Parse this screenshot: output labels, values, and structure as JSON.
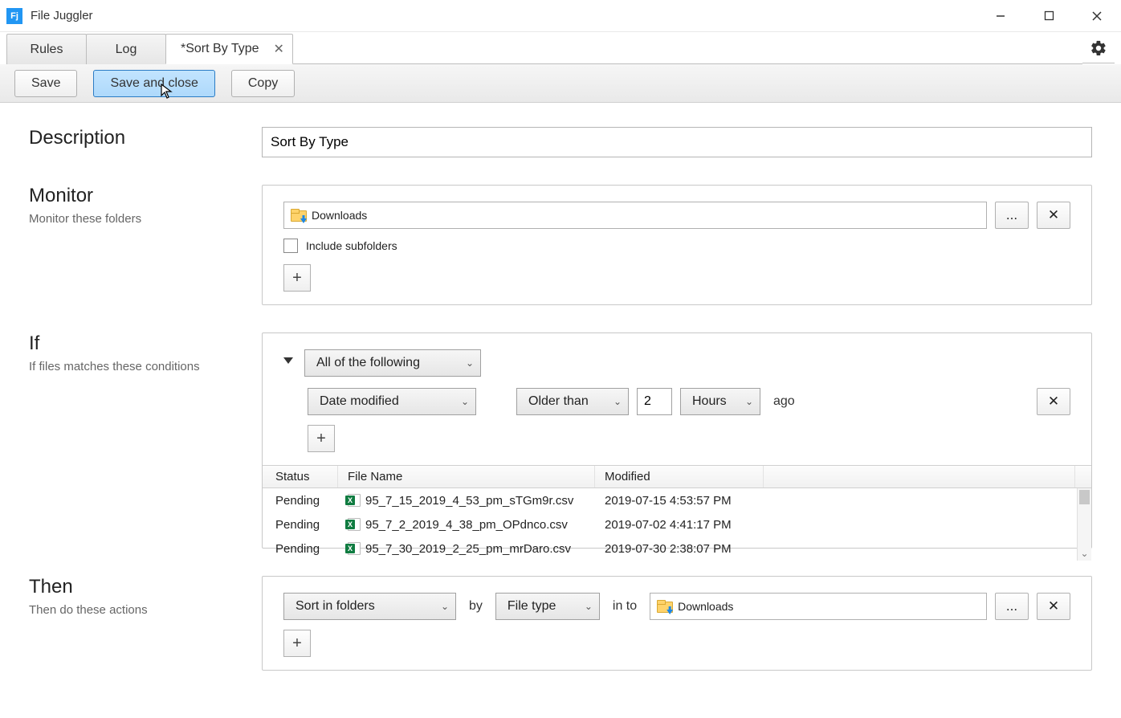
{
  "app_title": "File Juggler",
  "tabs": {
    "rules": "Rules",
    "log": "Log",
    "current": "*Sort By Type"
  },
  "toolbar": {
    "save": "Save",
    "save_close": "Save and close",
    "copy": "Copy"
  },
  "description": {
    "label": "Description",
    "value": "Sort By Type"
  },
  "monitor": {
    "label": "Monitor",
    "sub": "Monitor these folders",
    "folder": "Downloads",
    "include_subfolders": "Include subfolders",
    "browse": "...",
    "remove": "✕",
    "add": "+"
  },
  "if": {
    "label": "If",
    "sub": "If files matches these conditions",
    "logic": "All of the following",
    "cond": {
      "attr": "Date modified",
      "op": "Older than",
      "value": "2",
      "unit": "Hours",
      "suffix": "ago",
      "remove": "✕"
    },
    "add": "+"
  },
  "table": {
    "headers": {
      "status": "Status",
      "filename": "File Name",
      "modified": "Modified"
    },
    "rows": [
      {
        "status": "Pending",
        "name": "95_7_15_2019_4_53_pm_sTGm9r.csv",
        "modified": "2019-07-15 4:53:57 PM"
      },
      {
        "status": "Pending",
        "name": "95_7_2_2019_4_38_pm_OPdnco.csv",
        "modified": "2019-07-02 4:41:17 PM"
      },
      {
        "status": "Pending",
        "name": "95_7_30_2019_2_25_pm_mrDaro.csv",
        "modified": "2019-07-30 2:38:07 PM"
      }
    ]
  },
  "then": {
    "label": "Then",
    "sub": "Then do these actions",
    "action": "Sort in folders",
    "by_label": "by",
    "by_value": "File type",
    "into_label": "in to",
    "dest": "Downloads",
    "browse": "...",
    "remove": "✕",
    "add": "+"
  }
}
